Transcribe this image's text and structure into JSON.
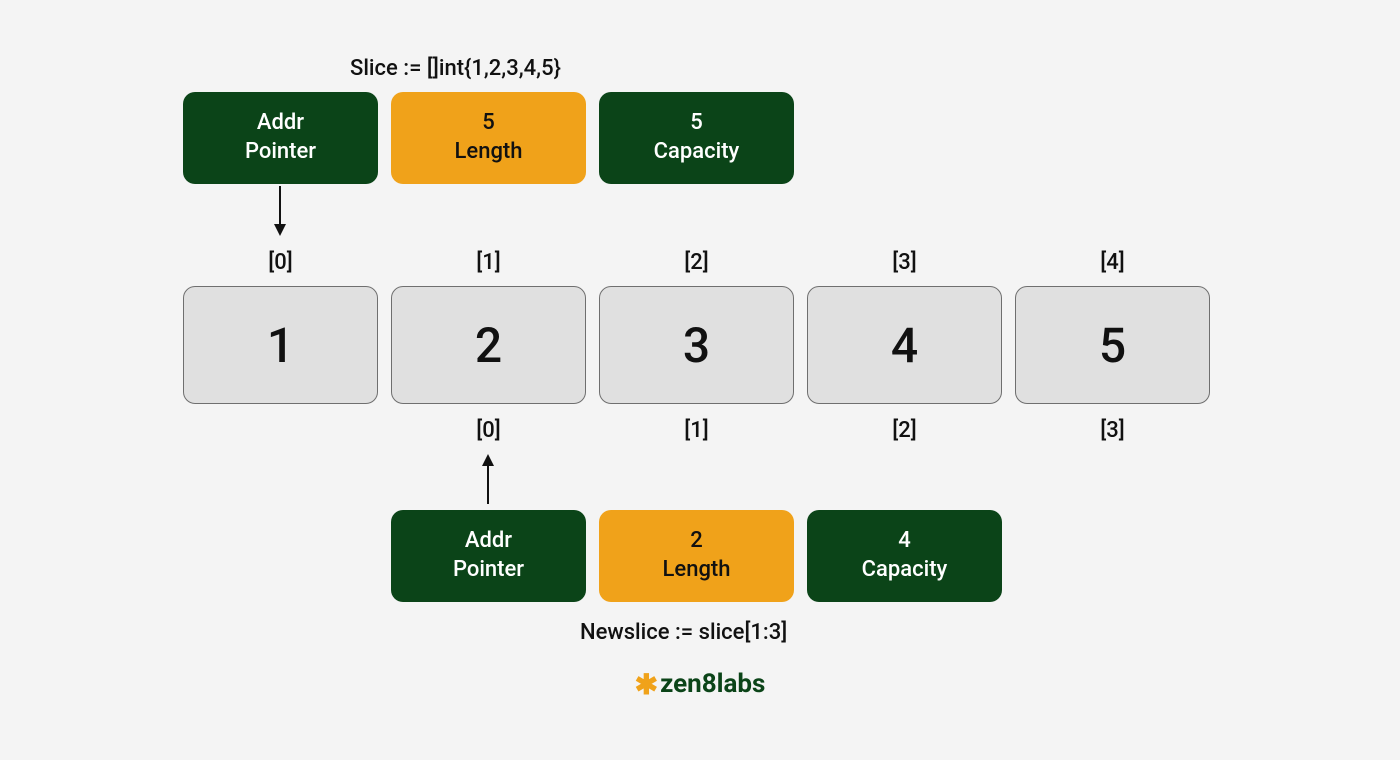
{
  "colors": {
    "dark_green": "#0b4418",
    "orange": "#f0a21a",
    "cell_bg": "#e0e0e0",
    "cell_border": "#6f6f6f",
    "page_bg": "#f4f4f4"
  },
  "slice": {
    "title": "Slice := []int{1,2,3,4,5}",
    "header": {
      "pointer": {
        "line1": "Addr",
        "line2": "Pointer"
      },
      "length": {
        "value": "5",
        "label": "Length"
      },
      "capacity": {
        "value": "5",
        "label": "Capacity"
      }
    },
    "top_indices": [
      "[0]",
      "[1]",
      "[2]",
      "[3]",
      "[4]"
    ],
    "values": [
      "1",
      "2",
      "3",
      "4",
      "5"
    ]
  },
  "newslice": {
    "title": "Newslice := slice[1:3]",
    "bottom_indices": [
      "[0]",
      "[1]",
      "[2]",
      "[3]"
    ],
    "header": {
      "pointer": {
        "line1": "Addr",
        "line2": "Pointer"
      },
      "length": {
        "value": "2",
        "label": "Length"
      },
      "capacity": {
        "value": "4",
        "label": "Capacity"
      }
    }
  },
  "logo": {
    "prefix": "✱",
    "text": "zen8labs"
  }
}
